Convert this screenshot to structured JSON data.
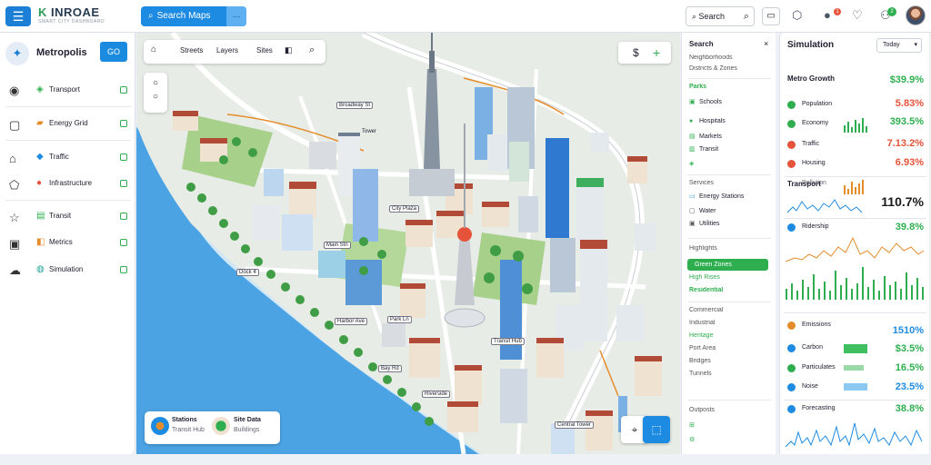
{
  "topbar": {
    "brand_prefix": "K",
    "brand_name": "INROAE",
    "brand_sub": "SMART CITY DASHBOARD",
    "search_label": "Search Maps",
    "global_search": "Search",
    "notif_count": "1",
    "status_count": "2"
  },
  "sidebar": {
    "header_name": "Metropolis",
    "header_button": "GO",
    "items": [
      {
        "label": "Transport",
        "icon": "leaf-icon"
      },
      {
        "label": "Energy Grid",
        "icon": "folder-icon"
      },
      {
        "label": "Traffic",
        "icon": "car-icon"
      },
      {
        "label": "Infrastructure",
        "icon": "pin-icon"
      },
      {
        "label": "Transit",
        "icon": "bus-icon"
      },
      {
        "label": "Metrics",
        "icon": "chart-icon"
      },
      {
        "label": "Simulation",
        "icon": "globe-icon"
      }
    ]
  },
  "map": {
    "toolbar": [
      "Streets",
      "Layers",
      "Sites"
    ],
    "currency_symbol": "$",
    "labels": [
      "Broadway St",
      "Tower",
      "City Plaza",
      "Main Stn",
      "Dock 4",
      "Harbor Ave",
      "Park Ln",
      "Transit Hub",
      "Bay Rd",
      "Riverside",
      "Central Tower"
    ],
    "legend": [
      {
        "title": "Stations",
        "sub": "Transit Hub"
      },
      {
        "title": "Site Data",
        "sub": "Buildings"
      }
    ]
  },
  "search_panel": {
    "title": "Search",
    "subtitle": "Neighborhoods",
    "subtitle2": "Districts & Zones",
    "rows_a": [
      "Parks",
      "Schools",
      "Hospitals",
      "Markets",
      "Transit"
    ],
    "section2": "Services",
    "rows_b": [
      "Energy Stations",
      "Water",
      "Utilities"
    ],
    "section3": "Highlights",
    "highlight": "Green Zones",
    "rows_c": [
      "High Rises",
      "Residential",
      "Commercial",
      "Industrial",
      "Heritage",
      "Port Area",
      "Bridges",
      "Tunnels",
      "Outposts"
    ]
  },
  "stats": {
    "title": "Simulation",
    "range": "Today",
    "sub1": "Metro Growth",
    "rows1": [
      {
        "label": "Population",
        "value": "$39.9%",
        "color": "#2eae4f"
      },
      {
        "label": "Economy",
        "value": "5.83%",
        "color": "#e5533a"
      },
      {
        "label": "Traffic",
        "value": "393.5%",
        "color": "#2eae4f"
      },
      {
        "label": "Housing",
        "value": "7.13.2%",
        "color": "#e5533a"
      },
      {
        "label": "Pollution",
        "value": "6.93%",
        "color": "#e5533a"
      }
    ],
    "sub2": "Transport",
    "big": "110.7%",
    "sub3": "Ridership",
    "big3": "39.8%",
    "sub4": "Emissions",
    "big4": "1510%",
    "rows4": [
      {
        "label": "Carbon",
        "value": "$3.5%",
        "color": "#2eae4f"
      },
      {
        "label": "Particulates",
        "value": "16.5%",
        "color": "#2eae4f"
      },
      {
        "label": "Noise",
        "value": "23.5%",
        "color": "#1e8be2"
      }
    ],
    "sub5": "Forecasting",
    "big5": "38.8%"
  }
}
